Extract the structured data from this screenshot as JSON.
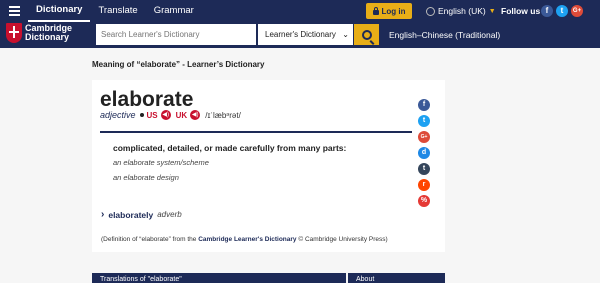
{
  "nav": {
    "links": [
      "Dictionary",
      "Translate",
      "Grammar"
    ],
    "login_label": "Log in",
    "language": "English (UK)",
    "follow_label": "Follow us",
    "social": [
      "f",
      "t",
      "G+"
    ]
  },
  "search": {
    "logo_line1": "Cambridge",
    "logo_line2": "Dictionary",
    "placeholder": "Search Learner's Dictionary",
    "dictionary": "Learner's Dictionary",
    "translation": "English–Chinese (Traditional)"
  },
  "page": {
    "meaning_title": "Meaning of “elaborate” - Learner’s Dictionary"
  },
  "entry": {
    "headword": "elaborate",
    "pos": "adjective",
    "us_label": "US",
    "uk_label": "UK",
    "ipa": "/ɪˈlæbᵊrət/",
    "definition": "complicated, detailed, or made carefully from many parts:",
    "examples": [
      "an elaborate system/scheme",
      "an elaborate design"
    ],
    "related_word": "elaborately",
    "related_pos": "adverb",
    "citation_prefix": "(Definition of “elaborate” from the ",
    "citation_source": "Cambridge Learner's Dictionary",
    "citation_suffix": " © Cambridge University Press)"
  },
  "share_icons": [
    "f",
    "t",
    "G+",
    "d",
    "t",
    "r",
    "%"
  ],
  "bottom": {
    "left": "Translations of \"elaborate\"",
    "right": "About"
  },
  "colors": {
    "brand_navy": "#1d2a57",
    "accent_gold": "#e8ae17",
    "audio_red": "#c8102e"
  }
}
